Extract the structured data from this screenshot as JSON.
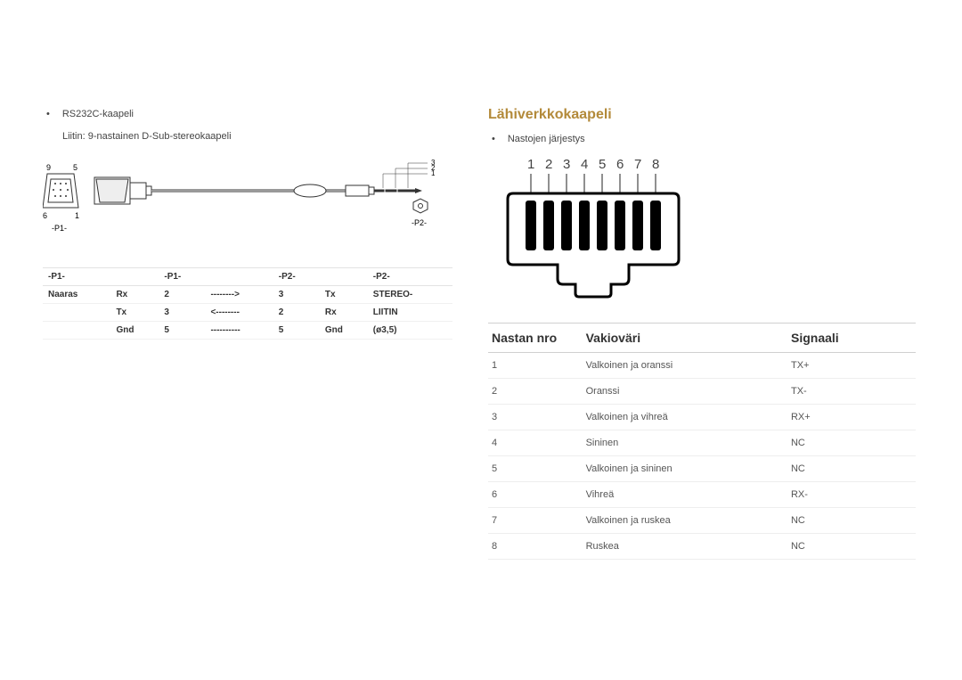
{
  "left": {
    "cable_name": "RS232C-kaapeli",
    "connector_desc": "Liitin: 9-nastainen D-Sub-stereokaapeli",
    "p1_label": "-P1-",
    "p2_label": "-P2-",
    "dsub_pins": {
      "tl": "9",
      "tr": "5",
      "bl": "6",
      "br": "1"
    },
    "jack_rings": {
      "a": "3",
      "b": "2",
      "c": "1"
    },
    "table": {
      "header": [
        "-P1-",
        "",
        "-P1-",
        "",
        "-P2-",
        "",
        "-P2-"
      ],
      "rows": [
        [
          "Naaras",
          "Rx",
          "2",
          "-------->",
          "3",
          "Tx",
          "STEREO-"
        ],
        [
          "",
          "Tx",
          "3",
          "<--------",
          "2",
          "Rx",
          "LIITIN"
        ],
        [
          "",
          "Gnd",
          "5",
          "----------",
          "5",
          "Gnd",
          "(ø3,5)"
        ]
      ]
    }
  },
  "right": {
    "heading": "Lähiverkkokaapeli",
    "sub": "Nastojen järjestys",
    "pin_numbers": [
      "1",
      "2",
      "3",
      "4",
      "5",
      "6",
      "7",
      "8"
    ],
    "table": {
      "headers": [
        "Nastan nro",
        "Vakioväri",
        "Signaali"
      ],
      "rows": [
        [
          "1",
          "Valkoinen ja oranssi",
          "TX+"
        ],
        [
          "2",
          "Oranssi",
          "TX-"
        ],
        [
          "3",
          "Valkoinen ja vihreä",
          "RX+"
        ],
        [
          "4",
          "Sininen",
          "NC"
        ],
        [
          "5",
          "Valkoinen ja sininen",
          "NC"
        ],
        [
          "6",
          "Vihreä",
          "RX-"
        ],
        [
          "7",
          "Valkoinen ja ruskea",
          "NC"
        ],
        [
          "8",
          "Ruskea",
          "NC"
        ]
      ]
    }
  }
}
